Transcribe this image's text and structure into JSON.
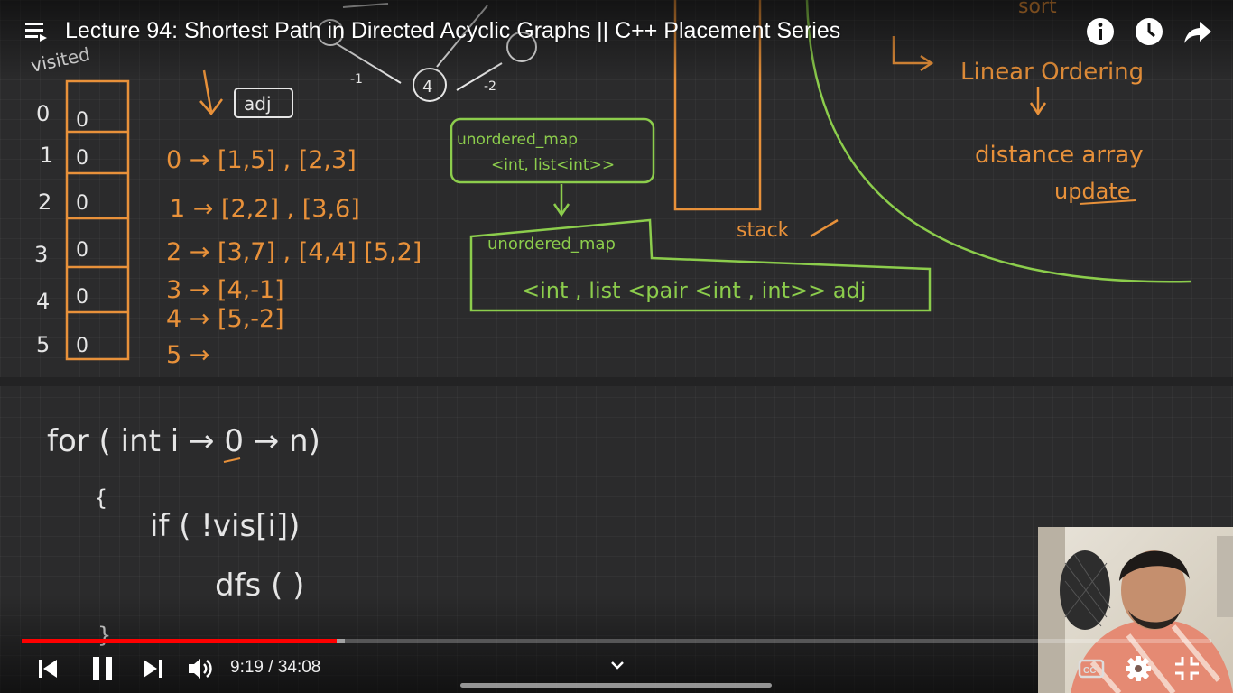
{
  "video": {
    "title": "Lecture 94: Shortest Path in Directed Acyclic Graphs || C++ Placement Series",
    "current_time": "9:19",
    "duration": "34:08",
    "time_separator": " / ",
    "progress_fraction": 0.265,
    "buffered_fraction": 0.272
  },
  "icons": {
    "menu": "playlist-menu-icon",
    "info": "info-icon",
    "watch_later": "clock-icon",
    "share": "share-arrow-icon",
    "prev": "skip-previous-icon",
    "pause": "pause-icon",
    "next": "skip-next-icon",
    "volume": "volume-icon",
    "expand": "chevron-down-icon",
    "captions": "captions-icon",
    "settings": "gear-icon",
    "exit_fullscreen": "exit-fullscreen-icon"
  },
  "colors": {
    "progress_played": "#ff0000",
    "chalk_orange": "#e8913a",
    "chalk_green": "#8ccd4c",
    "chalk_white": "#e6e6e6"
  },
  "board": {
    "visited_label": "visited",
    "adj_label": "adj",
    "indices": [
      "0",
      "1",
      "2",
      "3",
      "4",
      "5"
    ],
    "visited_values": [
      "0",
      "0",
      "0",
      "0",
      "0",
      "0"
    ],
    "adj_list": [
      "0 → [1,5] , [2,3]",
      "1 → [2,2] , [3,6]",
      "2 → [3,7] , [4,4] [5,2]",
      "3 → [4,-1]",
      "4 → [5,-2]",
      "5 →"
    ],
    "graph_node": "4",
    "graph_edge_left": "-1",
    "graph_edge_right": "-2",
    "map_small_line1": "unordered_map",
    "map_small_line2": "<int, list<int>>",
    "map_big_line1": "unordered_map",
    "map_big_line2": "<int , list <pair <int , int>> adj",
    "stack_label": "stack",
    "topo_label": "sort",
    "linear_ordering": "Linear Ordering",
    "distance_array": "distance array",
    "update": "update",
    "code_line1": "for ( int i → 0 → n)",
    "code_brace_open": "{",
    "code_line2": "if ( !vis[i])",
    "code_line3": "dfs ( )",
    "code_brace_close": "}"
  }
}
